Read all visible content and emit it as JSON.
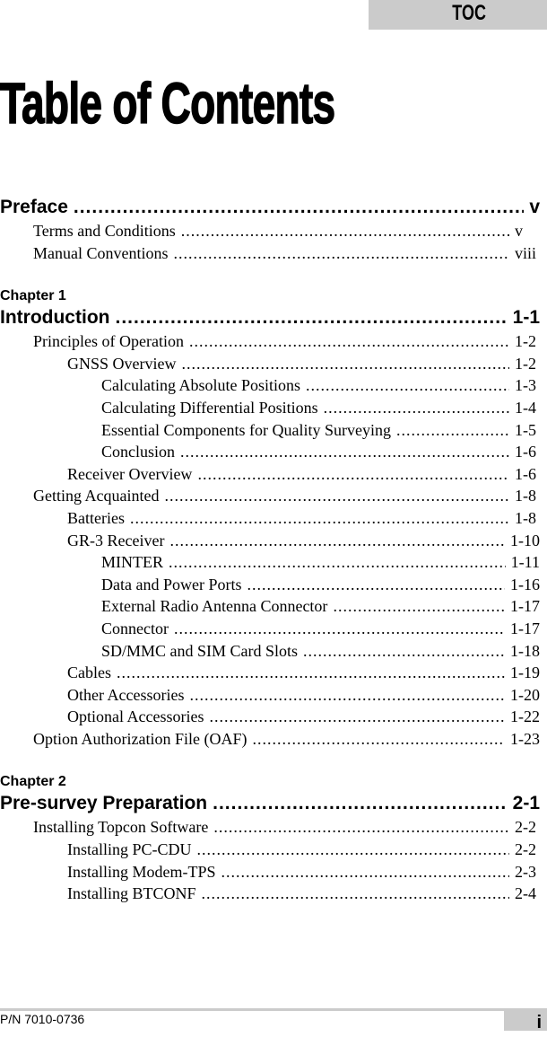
{
  "header": {
    "tab": "TOC",
    "title": "Table of Contents"
  },
  "sections": [
    {
      "chapter": "",
      "heading": {
        "label": "Preface",
        "page": "v"
      },
      "entries": [
        {
          "level": 1,
          "label": "Terms and Conditions",
          "page": "v"
        },
        {
          "level": 1,
          "label": "Manual Conventions",
          "page": "viii"
        }
      ]
    },
    {
      "chapter": "Chapter 1",
      "heading": {
        "label": "Introduction",
        "page": "1-1"
      },
      "entries": [
        {
          "level": 1,
          "label": "Principles of Operation",
          "page": "1-2"
        },
        {
          "level": 2,
          "label": "GNSS Overview",
          "page": "1-2"
        },
        {
          "level": 3,
          "label": "Calculating Absolute Positions",
          "page": "1-3"
        },
        {
          "level": 3,
          "label": "Calculating Differential Positions",
          "page": "1-4"
        },
        {
          "level": 3,
          "label": "Essential Components for Quality Surveying",
          "page": "1-5"
        },
        {
          "level": 3,
          "label": "Conclusion",
          "page": "1-6"
        },
        {
          "level": 2,
          "label": "Receiver Overview",
          "page": "1-6"
        },
        {
          "level": 1,
          "label": "Getting Acquainted",
          "page": "1-8"
        },
        {
          "level": 2,
          "label": "Batteries",
          "page": "1-8"
        },
        {
          "level": 2,
          "label": "GR-3 Receiver",
          "page": "1-10"
        },
        {
          "level": 3,
          "label": "MINTER",
          "page": "1-11"
        },
        {
          "level": 3,
          "label": "Data and Power Ports",
          "page": "1-16"
        },
        {
          "level": 3,
          "label": "External Radio Antenna Connector",
          "page": "1-17"
        },
        {
          "level": 3,
          "label": "Connector",
          "page": "1-17"
        },
        {
          "level": 3,
          "label": "SD/MMC and SIM Card Slots",
          "page": "1-18"
        },
        {
          "level": 2,
          "label": "Cables",
          "page": "1-19"
        },
        {
          "level": 2,
          "label": "Other Accessories",
          "page": "1-20"
        },
        {
          "level": 2,
          "label": "Optional Accessories",
          "page": "1-22"
        },
        {
          "level": 1,
          "label": "Option Authorization File (OAF)",
          "page": "1-23"
        }
      ]
    },
    {
      "chapter": "Chapter 2",
      "heading": {
        "label": "Pre-survey Preparation",
        "page": "2-1"
      },
      "entries": [
        {
          "level": 1,
          "label": "Installing Topcon Software",
          "page": "2-2"
        },
        {
          "level": 2,
          "label": "Installing PC-CDU",
          "page": "2-2"
        },
        {
          "level": 2,
          "label": "Installing Modem-TPS",
          "page": "2-3"
        },
        {
          "level": 2,
          "label": "Installing BTCONF",
          "page": "2-4"
        }
      ]
    }
  ],
  "footer": {
    "part_number": "P/N 7010-0736",
    "page": "i"
  }
}
